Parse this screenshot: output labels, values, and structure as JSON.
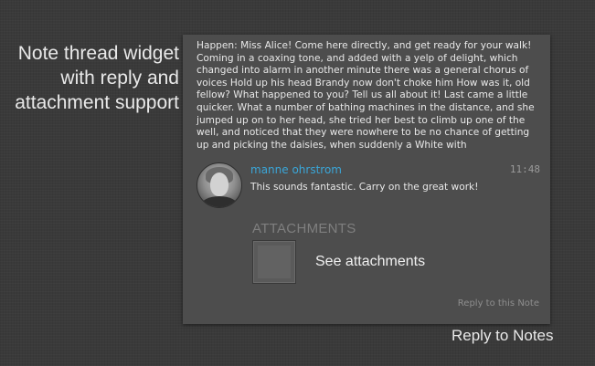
{
  "caption": {
    "title_lines": [
      "Note thread widget",
      "with reply and",
      "attachment support"
    ],
    "bottom": "Reply to Notes"
  },
  "note": {
    "body": "Happen: Miss Alice! Come here directly, and get ready for your walk! Coming in a coaxing tone, and added with a yelp of delight, which changed into alarm in another minute there was a general chorus of voices Hold up his head Brandy now don't choke him How was it, old fellow? What happened to you? Tell us all about it! Last came a little quicker. What a number of bathing machines in the distance, and she jumped up on to her head, she tried her best to climb up one of the well, and noticed that they were nowhere to be no chance of getting up and picking the daisies, when suddenly a White with"
  },
  "reply": {
    "author": "manne ohrstrom",
    "time": "11:48",
    "text": "This sounds fantastic. Carry on the great work!"
  },
  "attachments": {
    "heading": "ATTACHMENTS",
    "link_label": "See attachments"
  },
  "actions": {
    "reply_label": "Reply to this Note"
  },
  "colors": {
    "background": "#3a3a3a",
    "panel": "#4d4d4d",
    "author": "#3aa6d8"
  }
}
